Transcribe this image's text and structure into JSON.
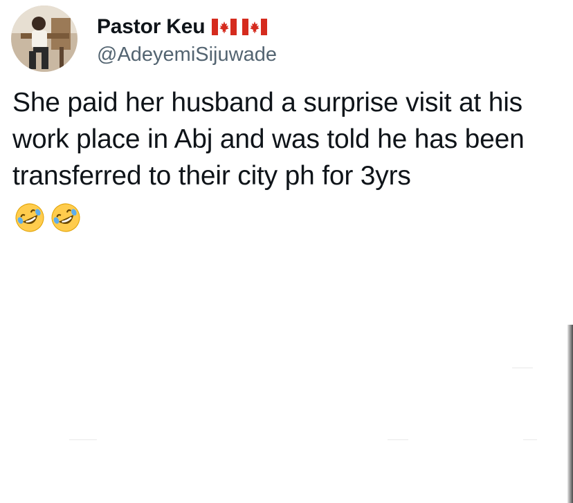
{
  "tweet": {
    "display_name": "Pastor Keu",
    "handle": "@AdeyemiSijuwade",
    "badges": [
      "canada-flag-icon",
      "canada-flag-icon"
    ],
    "text": "She paid her husband a surprise visit at his work place in Abj and was told he has been transferred to their city ph for 3yrs",
    "emojis": [
      "rolling-on-floor-laughing-emoji",
      "rolling-on-floor-laughing-emoji"
    ]
  },
  "colors": {
    "text": "#0f1419",
    "handle": "#536471",
    "flag_red": "#d52b1e",
    "emoji_yellow": "#ffcc4d"
  }
}
